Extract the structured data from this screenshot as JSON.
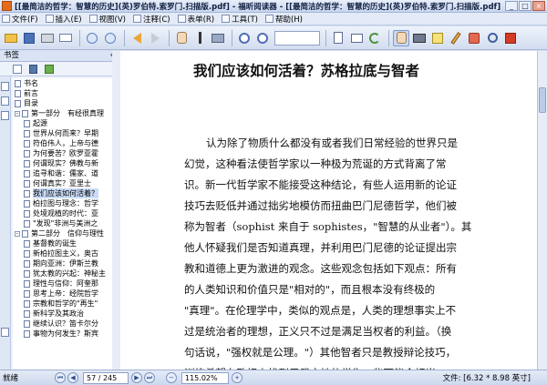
{
  "window": {
    "title": "[[最简洁的哲学：智慧的历史](英)罗伯特.索罗门.扫描版.pdf] - 福昕阅读器 - [[最简洁的哲学：智慧的历史](英)罗伯特.索罗门.扫描版.pdf]"
  },
  "menu": [
    "文件(F)",
    "插入(E)",
    "视图(V)",
    "注释(C)",
    "表单(R)",
    "工具(T)",
    "帮助(H)"
  ],
  "toolbar": {
    "zoom_value": ""
  },
  "sidebar": {
    "header": "书签",
    "items": [
      {
        "label": "书名",
        "level": 0
      },
      {
        "label": "前言",
        "level": 0
      },
      {
        "label": "目录",
        "level": 0
      },
      {
        "label": "第一部分　有经很真理",
        "level": 0,
        "expander": "-"
      },
      {
        "label": "起源",
        "level": 1
      },
      {
        "label": "世界从何而来？早期",
        "level": 1
      },
      {
        "label": "符伯伟人，上帝与德",
        "level": 1
      },
      {
        "label": "为何要苦？欧罗亚霍",
        "level": 1
      },
      {
        "label": "何谓现实？佛教与新",
        "level": 1
      },
      {
        "label": "追寻和谐：儒家、道",
        "level": 1
      },
      {
        "label": "何谓真实？亚里士",
        "level": 1
      },
      {
        "label": "我们应该如何活着？",
        "level": 1,
        "selected": true
      },
      {
        "label": "柏拉图与理念：哲学",
        "level": 1
      },
      {
        "label": "处境观植的时代：亚",
        "level": 1
      },
      {
        "label": "\"发现\"非洲与美洲之",
        "level": 1
      },
      {
        "label": "第二部分　信仰与理性",
        "level": 0,
        "expander": "-"
      },
      {
        "label": "基督教的诞生",
        "level": 1
      },
      {
        "label": "新柏拉图主义，奥古",
        "level": 1
      },
      {
        "label": "期向亚洲：伊斯兰教",
        "level": 1
      },
      {
        "label": "犹太教的兴起：神秘主",
        "level": 1
      },
      {
        "label": "理性与信仰：阿奎那",
        "level": 1
      },
      {
        "label": "思考上帝：经院哲学",
        "level": 1
      },
      {
        "label": "宗教和哲学的\"再生\"",
        "level": 1
      },
      {
        "label": "新科学及其政治",
        "level": 1
      },
      {
        "label": "继续认识？笛卡尔分",
        "level": 1
      },
      {
        "label": "事物为何发生？斯宾",
        "level": 1
      }
    ]
  },
  "document": {
    "title": "我们应该如何活着？苏格拉底与智者",
    "lines": [
      {
        "text": "认为除了物质什么都没有或者我们日常经验的世界只是",
        "indent": true
      },
      {
        "text": "幻觉，这种看法使哲学家以一种极为荒诞的方式背离了常",
        "indent": false
      },
      {
        "text": "识。新一代哲学家不能接受这种结论，有些人运用新的论证",
        "indent": false
      },
      {
        "text": "技巧去贬低并通过拙劣地模仿而扭曲巴门尼德哲学，他们被",
        "indent": false
      },
      {
        "text": "称为智者（sophist 来自于 sophistes，\"智慧的从业者\"）。其",
        "indent": false
      },
      {
        "text": "他人怀疑我们是否知道真理，并利用巴门尼德的论证提出宗",
        "indent": false
      },
      {
        "text": "教和道德上更为激进的观念。这些观念包括如下观点：所有",
        "indent": false
      },
      {
        "text": "的人类知识和价值只是\"相对的\"，而且根本没有终极的",
        "indent": false
      },
      {
        "text": "\"真理\"。在伦理学中，类似的观点是，人类的理想事实上不",
        "indent": false
      },
      {
        "text": "过是统治者的理想，正义只不过是满足当权者的利益。（换",
        "indent": false
      },
      {
        "text": "句话说，\"强权就是公理。\"）其他智者只是教授辩论技巧，",
        "indent": false
      },
      {
        "text": "训练希望在政坛上找到用武之地的学生一些可能会相当",
        "indent": false
      }
    ]
  },
  "status": {
    "left": "就绪",
    "page_field": "57 / 245",
    "zoom_field": "115.02%",
    "doc_size": "文件: [6.32 * 8.98 英寸]"
  }
}
